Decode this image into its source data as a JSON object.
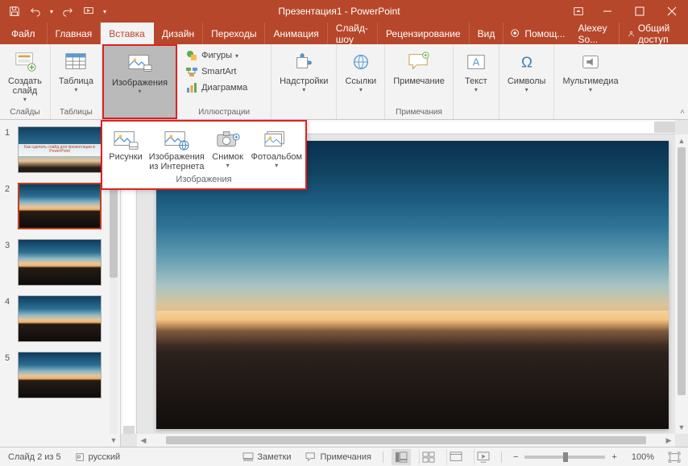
{
  "app": {
    "title": "Презентация1 - PowerPoint"
  },
  "qat": {
    "save": "save",
    "undo": "undo",
    "redo": "redo",
    "startfrom": "start-from-beginning"
  },
  "tabs": {
    "file": "Файл",
    "items": [
      "Главная",
      "Вставка",
      "Дизайн",
      "Переходы",
      "Анимация",
      "Слайд-шоу",
      "Рецензирование",
      "Вид"
    ],
    "active_index": 1,
    "help": "Помощ...",
    "user": "Alexey So...",
    "share": "Общий доступ"
  },
  "ribbon": {
    "groups": {
      "slides": {
        "label": "Слайды",
        "new_slide": "Создать\nслайд"
      },
      "tables": {
        "label": "Таблицы",
        "table": "Таблица"
      },
      "images": {
        "label": "",
        "images": "Изображения"
      },
      "illustrations": {
        "label": "Иллюстрации",
        "shapes": "Фигуры",
        "smartart": "SmartArt",
        "chart": "Диаграмма"
      },
      "addins": {
        "label": "",
        "addins": "Надстройки"
      },
      "links": {
        "label": "",
        "links": "Ссылки"
      },
      "comments": {
        "label": "Примечания",
        "comment": "Примечание"
      },
      "text": {
        "label": "",
        "text": "Текст"
      },
      "symbols": {
        "label": "",
        "symbols": "Символы"
      },
      "media": {
        "label": "",
        "media": "Мультимедиа"
      }
    }
  },
  "images_dropdown": {
    "label": "Изображения",
    "items": {
      "pictures": "Рисунки",
      "online": "Изображения\nиз Интернета",
      "screenshot": "Снимок",
      "album": "Фотоальбом"
    }
  },
  "thumbnails": {
    "slide1_title": "Как сделать слайд для презентации в PowerPoint",
    "count": 5,
    "selected": 2
  },
  "status": {
    "slide_info": "Слайд 2 из 5",
    "lang": "русский",
    "notes": "Заметки",
    "comments": "Примечания",
    "zoom": "100%"
  },
  "colors": {
    "accent": "#b7472a"
  }
}
